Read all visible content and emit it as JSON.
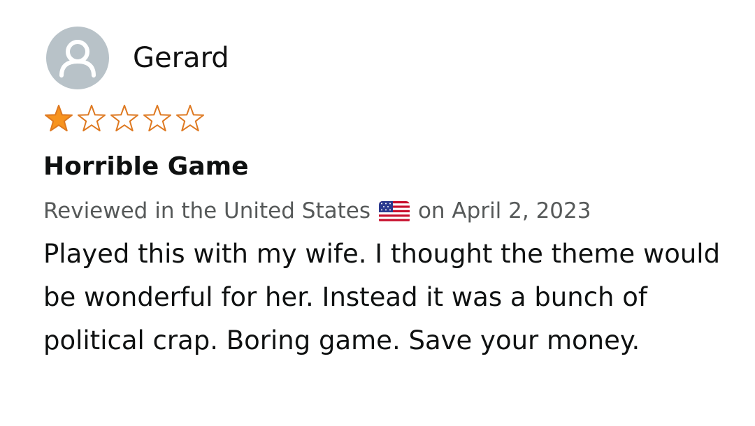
{
  "review": {
    "reviewer_name": "Gerard",
    "rating": 1,
    "rating_max": 5,
    "title": "Horrible Game",
    "reviewed_in": "Reviewed in the United States",
    "date_text": "on April 2, 2023",
    "body": "Played this with my wife. I thought the theme would be wonderful for her. Instead it was a bunch of political crap. Boring game. Save your money.",
    "icons": {
      "avatar": "default-user-icon",
      "star": "star-icon",
      "flag": "us-flag-icon"
    }
  },
  "colors": {
    "star_fill": "#f7931e",
    "star_outline": "#de7921",
    "avatar_bg": "#b8c2c8"
  }
}
